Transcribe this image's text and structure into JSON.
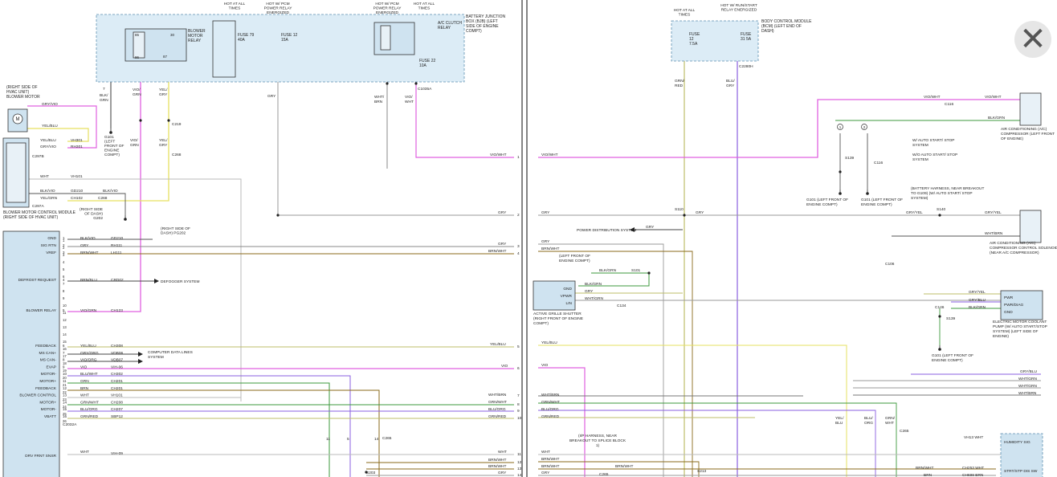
{
  "close_glyph": "✕",
  "colors": {
    "pink": "#e060e0",
    "violet": "#8a5fe0",
    "yellow": "#e6e060",
    "gray": "#9a9a9a",
    "green": "#3c9a3c",
    "brown": "#8a6a1a",
    "orange": "#e09a3a",
    "olive": "#bdbd6a",
    "box_fill": "#dcecf6"
  },
  "left": {
    "hot_labels": [
      "HOT AT ALL TIMES",
      "HOT W/ PCM POWER RELAY ENERGIZED",
      "HOT W/ PCM POWER RELAY ENERGIZED",
      "HOT AT ALL TIMES"
    ],
    "bjb_label": "BATTERY JUNCTION BOX (BJB) (LEFT SIDE OF ENGINE COMPT)",
    "blower_relay": "BLOWER MOTOR RELAY",
    "ac_relay": "A/C CLUTCH RELAY",
    "fuses": [
      "FUSE 79 40A",
      "FUSE 12 15A",
      "FUSE 22 10A"
    ],
    "blower_motor": "(RIGHT SIDE OF HVAC UNIT) BLOWER MOTOR",
    "bmcm": "BLOWER MOTOR CONTROL MODULE (RIGHT SIDE OF HVAC UNIT)",
    "connectors": [
      "C297B",
      "C297A",
      "C219",
      "C268",
      "C1035A",
      "C2032A",
      "C2302",
      "C265",
      "C268"
    ],
    "grounds": [
      "G101 (LEFT FRONT OF ENGINE COMPT)",
      "(RIGHT SIDE OF DASH) G202",
      "(RIGHT SIDE OF DASH) PG202"
    ],
    "wires": [
      "GRY/VIO",
      "YEL/BLU",
      "YEL/BLU",
      "GRY/VIO",
      "WHT",
      "BLK/VIO",
      "YEL/GRN",
      "BLK/VIO",
      "BLK/GRN",
      "VIO/GRN",
      "YEL/GRY",
      "GRY",
      "WHT/BRN",
      "VIO/WHT"
    ],
    "circuits": [
      "RH301",
      "VH301",
      "RH301",
      "VH101",
      "GD210",
      "CH102"
    ],
    "pins": [
      {
        "name": "GND",
        "wire": "BLK/VIO",
        "circuit": "GD210"
      },
      {
        "name": "SIG RTN",
        "wire": "GRY",
        "circuit": "RH111"
      },
      {
        "name": "VREF",
        "wire": "BRN/WHT",
        "circuit": "LH111"
      },
      {
        "name": "DEFROST REQUEST",
        "wire": "BRN/BLU",
        "circuit": "CRD02"
      },
      {
        "name": "BLOWER RELAY",
        "wire": "VIO/GRN",
        "circuit": "CH123"
      },
      {
        "name": "FEEDBACK",
        "wire": "YEL/BLU",
        "circuit": "CH308"
      },
      {
        "name": "MS CAN+",
        "wire": "GRY/ORG",
        "circuit": "VDB06"
      },
      {
        "name": "MS CAN-",
        "wire": "VIO/ORG",
        "circuit": "VDB07"
      },
      {
        "name": "EVAP",
        "wire": "VIO",
        "circuit": "VIH-06"
      },
      {
        "name": "MOTOR-",
        "wire": "BLU/WHT",
        "circuit": "CH302"
      },
      {
        "name": "MOTOR+",
        "wire": "GRN",
        "circuit": "CH201"
      },
      {
        "name": "FEEDBACK",
        "wire": "BRN",
        "circuit": "CH201"
      },
      {
        "name": "BLOWER CONTROL",
        "wire": "WHT",
        "circuit": "VH101"
      },
      {
        "name": "MOTOR+",
        "wire": "GRN/WHT",
        "circuit": "CH208"
      },
      {
        "name": "MOTOR-",
        "wire": "BLU/ORG",
        "circuit": "CH207"
      },
      {
        "name": "VBATT",
        "wire": "GRN/RED",
        "circuit": "SBP12"
      }
    ],
    "drv_frnt_snsr": "DRV FRNT SNSR",
    "drv_wire": "WHT",
    "drv_circuit": "VIH-09",
    "defogger": "DEFOGGER SYSTEM",
    "computer": "COMPUTER DATA LINES SYSTEM",
    "right_edge": [
      {
        "wire": "VIO/WHT",
        "num": "1"
      },
      {
        "wire": "GRY",
        "num": "2"
      },
      {
        "wire": "GRY",
        "num": "3"
      },
      {
        "wire": "BRN/WHT",
        "num": "4"
      },
      {
        "wire": "YEL/BLU",
        "num": "5"
      },
      {
        "wire": "VIO",
        "num": "6"
      },
      {
        "wire": "WHT/BRN",
        "num": "7"
      },
      {
        "wire": "GRN/WHT",
        "num": "8"
      },
      {
        "wire": "BLU/ORG",
        "num": "9"
      },
      {
        "wire": "GRN/RED",
        "num": "10"
      },
      {
        "wire": "WHT",
        "num": "11"
      },
      {
        "wire": "BRN/WHT",
        "num": "12"
      },
      {
        "wire": "BRN/WHT",
        "num": "13"
      },
      {
        "wire": "GRY",
        "num": "14"
      }
    ]
  },
  "right": {
    "hot_labels": [
      "HOT AT ALL TIMES",
      "HOT W/ RUN/START RELAY ENERGIZED"
    ],
    "bcm": "BODY CONTROL MODULE (BCM) (LEFT END OF DASH)",
    "fuses": [
      "FUSE 12 7.5A",
      "FUSE 31 5A"
    ],
    "connector_c2280h": "C2280H",
    "wires_top": [
      "GRN/RED",
      "BLU/GRY"
    ],
    "compressor": "AIR CONDITIONING (A/C) COMPRESSOR (LEFT FRONT OF ENGINE)",
    "solenoid": "AIR CONDITIONING (A/C) COMPRESSOR CONTROL SOLENOID (NEAR A/C COMPRESSOR)",
    "legend": [
      "W/ AUTO START/ STOP SYSTEM",
      "W/O AUTO START/ STOP SYSTEM"
    ],
    "battery_harness": "(BATTERY HARNESS, NEAR BREAKOUT TO G109) (W/ AUTO START/ STOP SYSTEM)",
    "power_dist": "POWER DISTRIBUTION SYSTEM",
    "shutter": "ACTIVE GRILLE SHUTTER (RIGHT FRONT OF ENGINE COMPT)",
    "shutter_pins": [
      "GND",
      "VPWR",
      "LIN"
    ],
    "coolant_pump": "ELECTRIC MOTOR COOLANT PUMP (W/ AUTO START/STOP SYSTEM) (LEFT SIDE OF ENGINE)",
    "pump_pins": [
      "PWR",
      "PWR/DIAG",
      "GND"
    ],
    "humidity": [
      "HUMIDITY SIG",
      "STRT/STP DIS SW"
    ],
    "ip_harness": "(I/P HARNESS, NEAR BREAKOUT TO SPLICE BLOCK 1)",
    "grounds": [
      "G101 (LEFT FRONT OF ENGINE COMPT)",
      "G101 (LEFT FRONT OF ENGINE COMPT)",
      "G101 (LEFT FRONT OF ENGINE COMPT)"
    ],
    "splices": [
      "S110",
      "S101",
      "S139",
      "S140",
      "S213",
      "S139"
    ],
    "connectors": [
      "C116",
      "C116",
      "C1/2",
      "C1/3",
      "C106",
      "C265",
      "C265"
    ],
    "wires": [
      "VIO/WHT",
      "VIO/WHT",
      "BLK/GRN",
      "GRY/YEL",
      "WHT/BRN",
      "GRY",
      "BLK/GRN",
      "GRY",
      "WHT/GRN",
      "GRY/YEL",
      "GRY/BLU",
      "BLK/GRN",
      "BLK/GRN",
      "BLK/GRN",
      "GRY/BLU",
      "WHT/GRN",
      "WHT/GRN",
      "WHT/BRN",
      "YEL/BLU",
      "BLU/ORG",
      "GRN/WHT",
      "WHT",
      "BRN/WHT",
      "BRN/WHT",
      "BRN/WHT",
      "BRN",
      "VH13 WHT",
      "CH253 WHT",
      "CH698 BRN"
    ]
  }
}
